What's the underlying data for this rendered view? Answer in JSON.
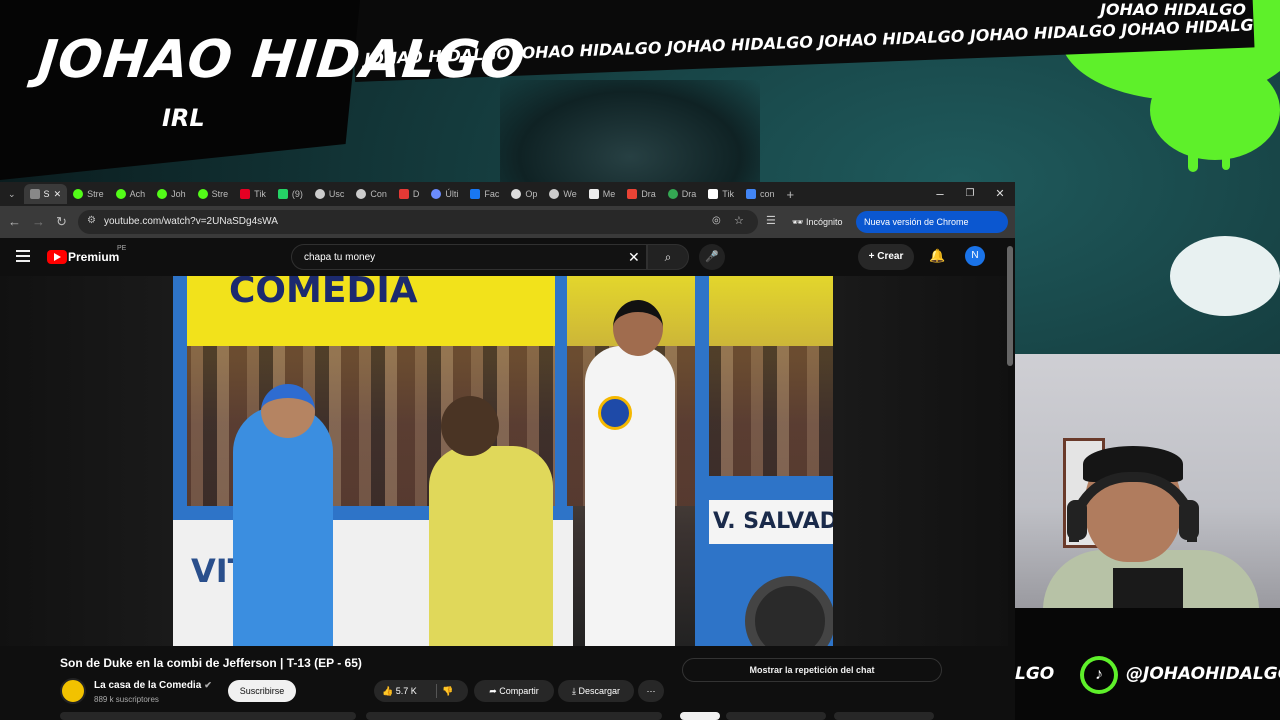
{
  "overlay": {
    "streamer_name": "JOHAO HIDALGO",
    "subtitle": "IRL",
    "ticker_text": "JOHAO HIDALGO JOHAO HIDALGO JOHAO HIDALGO JOHAO HIDALGO JOHAO HIDALGO JOHAO HIDALGO JOHA",
    "ticker_top_text": "JOHAO HIDALGO",
    "handle": "@JOHAOHIDALGO",
    "handle_fragment": "LGO",
    "accent_color": "#5ef02a"
  },
  "browser": {
    "tabs": [
      {
        "label": "S",
        "icon": "speaker-icon",
        "active": true,
        "color": "#888888"
      },
      {
        "label": "Stre",
        "icon": "kick-icon",
        "color": "#53fc18"
      },
      {
        "label": "Ach",
        "icon": "kick-icon",
        "color": "#53fc18"
      },
      {
        "label": "Joh",
        "icon": "kick-icon",
        "color": "#53fc18"
      },
      {
        "label": "Stre",
        "icon": "kick-icon",
        "color": "#53fc18"
      },
      {
        "label": "Tik",
        "icon": "pinterest-icon",
        "color": "#e60023"
      },
      {
        "label": "(9)",
        "icon": "whatsapp-icon",
        "color": "#25d366"
      },
      {
        "label": "Usc",
        "icon": "site-icon",
        "color": "#cccccc"
      },
      {
        "label": "Con",
        "icon": "site-icon",
        "color": "#cccccc"
      },
      {
        "label": "D",
        "icon": "record-icon",
        "color": "#e53935"
      },
      {
        "label": "Últi",
        "icon": "globe-icon",
        "color": "#6b8cff"
      },
      {
        "label": "Fac",
        "icon": "facebook-icon",
        "color": "#1877f2"
      },
      {
        "label": "Op",
        "icon": "openai-icon",
        "color": "#dddddd"
      },
      {
        "label": "We",
        "icon": "site-icon",
        "color": "#cccccc"
      },
      {
        "label": "Me",
        "icon": "messenger-icon",
        "color": "#eeeeee"
      },
      {
        "label": "Dra",
        "icon": "gmail-icon",
        "color": "#ea4335"
      },
      {
        "label": "Dra",
        "icon": "site-icon",
        "color": "#34a853"
      },
      {
        "label": "Tik",
        "icon": "tiktok-icon",
        "color": "#ffffff"
      },
      {
        "label": "con",
        "icon": "google-icon",
        "color": "#4285f4"
      }
    ],
    "new_tab": "+",
    "minimize": "–",
    "maximize": "❐",
    "close": "✕",
    "back": "←",
    "forward": "→",
    "reload": "↻",
    "url": "youtube.com/watch?v=2UNaSDg4sWA",
    "incognito_label": "Incógnito",
    "update_label": "Nueva versión de Chrome disponible"
  },
  "youtube": {
    "brand": "Premium",
    "region": "PE",
    "search_value": "chapa tu money",
    "create_label": "Crear",
    "avatar_letter": "N",
    "video": {
      "banner_text": "COMEDIA",
      "bus_text_left": "VITO PT",
      "bus_text_right": "V. SALVADOR"
    },
    "title": "Son de Duke en la combi de Jefferson | T-13 (EP - 65)",
    "channel_name": "La casa de la Comedia",
    "subscribers": "889 k suscriptores",
    "subscribe_label": "Suscribirse",
    "likes": "5.7 K",
    "share_label": "Compartir",
    "download_label": "Descargar",
    "more_label": "⋯",
    "chat_replay_label": "Mostrar la repetición del chat"
  }
}
